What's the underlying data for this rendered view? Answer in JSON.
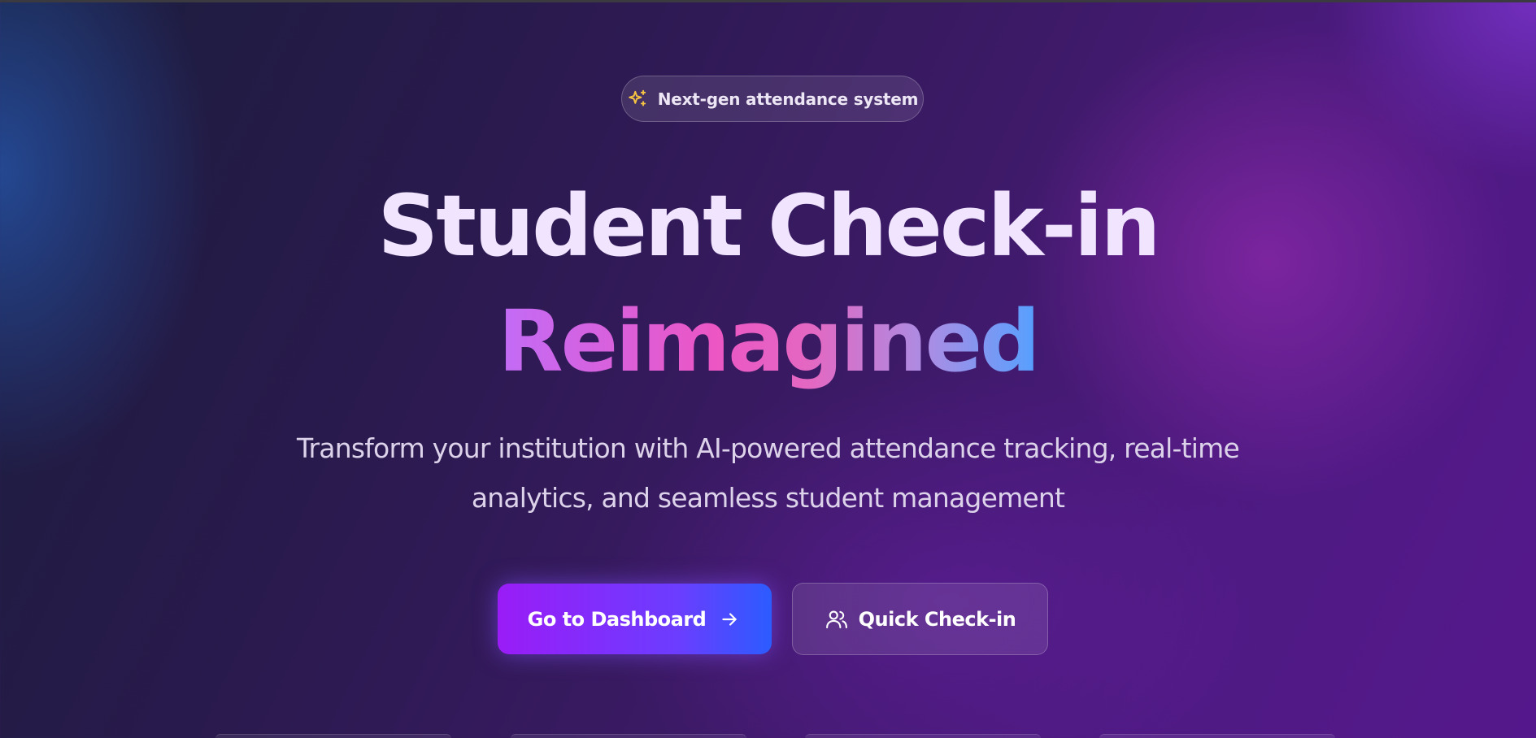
{
  "badge": {
    "icon": "sparkles-icon",
    "text": "Next-gen attendance system",
    "icon_color": "#f5c542"
  },
  "hero": {
    "title_line1": "Student Check-in",
    "title_line2": "Reimagined",
    "subtitle": "Transform your institution with AI-powered attendance tracking, real-time analytics, and seamless student management"
  },
  "actions": {
    "primary": {
      "label": "Go to Dashboard",
      "icon": "arrow-right-icon"
    },
    "secondary": {
      "label": "Quick Check-in",
      "icon": "users-icon"
    }
  },
  "colors": {
    "accent_purple": "#9a1cf7",
    "accent_blue": "#2c5cff",
    "title_light": "#f1e4ff"
  }
}
